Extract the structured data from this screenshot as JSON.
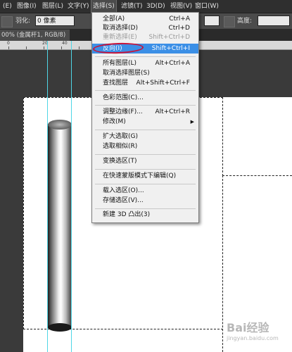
{
  "menubar": {
    "items": [
      {
        "label": "(E)"
      },
      {
        "label": "图像(I)"
      },
      {
        "label": "图层(L)"
      },
      {
        "label": "文字(Y)"
      },
      {
        "label": "选择(S)"
      },
      {
        "label": "滤镜(T)"
      },
      {
        "label": "3D(D)"
      },
      {
        "label": "视图(V)"
      },
      {
        "label": "窗口(W)"
      }
    ]
  },
  "options": {
    "feather_label": "羽化:",
    "feather_value": "0 像素",
    "height_label": "高度:"
  },
  "document_tab": {
    "title": "00% (金属杆1, RGB/8)"
  },
  "ruler": {
    "ticks": [
      "0",
      "20",
      "40"
    ]
  },
  "select_menu": {
    "items": [
      {
        "label": "全部(A)",
        "shortcut": "Ctrl+A"
      },
      {
        "label": "取消选择(D)",
        "shortcut": "Ctrl+D"
      },
      {
        "label": "重新选择(E)",
        "shortcut": "Shift+Ctrl+D"
      },
      {
        "label": "反向(I)",
        "shortcut": "Shift+Ctrl+I"
      },
      {
        "label": "所有图层(L)",
        "shortcut": "Alt+Ctrl+A"
      },
      {
        "label": "取消选择图层(S)",
        "shortcut": ""
      },
      {
        "label": "查找图层",
        "shortcut": "Alt+Shift+Ctrl+F"
      },
      {
        "label": "色彩范围(C)...",
        "shortcut": ""
      },
      {
        "label": "调整边缘(F)...",
        "shortcut": "Alt+Ctrl+R"
      },
      {
        "label": "修改(M)",
        "shortcut": ""
      },
      {
        "label": "扩大选取(G)",
        "shortcut": ""
      },
      {
        "label": "选取相似(R)",
        "shortcut": ""
      },
      {
        "label": "变换选区(T)",
        "shortcut": ""
      },
      {
        "label": "在快速蒙版模式下编辑(Q)",
        "shortcut": ""
      },
      {
        "label": "载入选区(O)...",
        "shortcut": ""
      },
      {
        "label": "存储选区(V)...",
        "shortcut": ""
      },
      {
        "label": "新建 3D 凸出(3)",
        "shortcut": ""
      }
    ]
  },
  "watermark": {
    "text": "Bai经验",
    "sub": "jingyan.baidu.com"
  }
}
